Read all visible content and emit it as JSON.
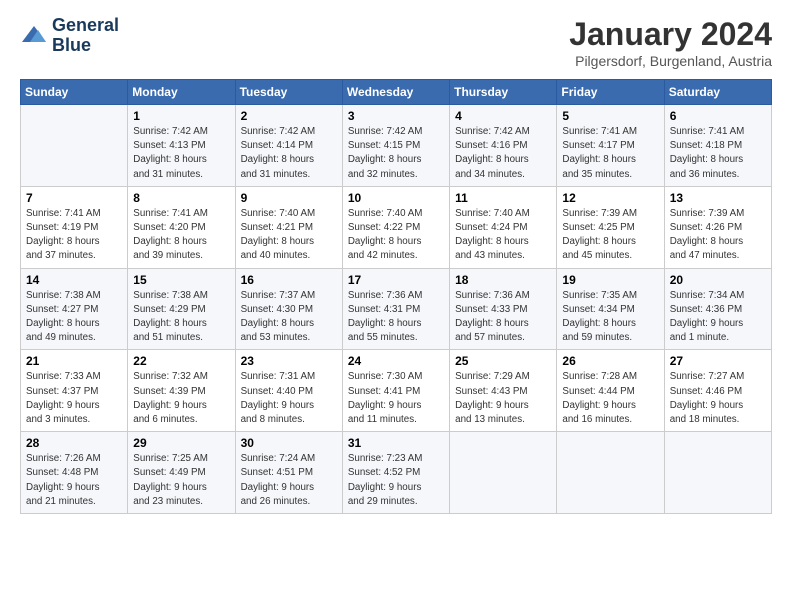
{
  "logo": {
    "line1": "General",
    "line2": "Blue"
  },
  "title": "January 2024",
  "subtitle": "Pilgersdorf, Burgenland, Austria",
  "headers": [
    "Sunday",
    "Monday",
    "Tuesday",
    "Wednesday",
    "Thursday",
    "Friday",
    "Saturday"
  ],
  "weeks": [
    [
      {
        "day": "",
        "info": ""
      },
      {
        "day": "1",
        "info": "Sunrise: 7:42 AM\nSunset: 4:13 PM\nDaylight: 8 hours\nand 31 minutes."
      },
      {
        "day": "2",
        "info": "Sunrise: 7:42 AM\nSunset: 4:14 PM\nDaylight: 8 hours\nand 31 minutes."
      },
      {
        "day": "3",
        "info": "Sunrise: 7:42 AM\nSunset: 4:15 PM\nDaylight: 8 hours\nand 32 minutes."
      },
      {
        "day": "4",
        "info": "Sunrise: 7:42 AM\nSunset: 4:16 PM\nDaylight: 8 hours\nand 34 minutes."
      },
      {
        "day": "5",
        "info": "Sunrise: 7:41 AM\nSunset: 4:17 PM\nDaylight: 8 hours\nand 35 minutes."
      },
      {
        "day": "6",
        "info": "Sunrise: 7:41 AM\nSunset: 4:18 PM\nDaylight: 8 hours\nand 36 minutes."
      }
    ],
    [
      {
        "day": "7",
        "info": "Sunrise: 7:41 AM\nSunset: 4:19 PM\nDaylight: 8 hours\nand 37 minutes."
      },
      {
        "day": "8",
        "info": "Sunrise: 7:41 AM\nSunset: 4:20 PM\nDaylight: 8 hours\nand 39 minutes."
      },
      {
        "day": "9",
        "info": "Sunrise: 7:40 AM\nSunset: 4:21 PM\nDaylight: 8 hours\nand 40 minutes."
      },
      {
        "day": "10",
        "info": "Sunrise: 7:40 AM\nSunset: 4:22 PM\nDaylight: 8 hours\nand 42 minutes."
      },
      {
        "day": "11",
        "info": "Sunrise: 7:40 AM\nSunset: 4:24 PM\nDaylight: 8 hours\nand 43 minutes."
      },
      {
        "day": "12",
        "info": "Sunrise: 7:39 AM\nSunset: 4:25 PM\nDaylight: 8 hours\nand 45 minutes."
      },
      {
        "day": "13",
        "info": "Sunrise: 7:39 AM\nSunset: 4:26 PM\nDaylight: 8 hours\nand 47 minutes."
      }
    ],
    [
      {
        "day": "14",
        "info": "Sunrise: 7:38 AM\nSunset: 4:27 PM\nDaylight: 8 hours\nand 49 minutes."
      },
      {
        "day": "15",
        "info": "Sunrise: 7:38 AM\nSunset: 4:29 PM\nDaylight: 8 hours\nand 51 minutes."
      },
      {
        "day": "16",
        "info": "Sunrise: 7:37 AM\nSunset: 4:30 PM\nDaylight: 8 hours\nand 53 minutes."
      },
      {
        "day": "17",
        "info": "Sunrise: 7:36 AM\nSunset: 4:31 PM\nDaylight: 8 hours\nand 55 minutes."
      },
      {
        "day": "18",
        "info": "Sunrise: 7:36 AM\nSunset: 4:33 PM\nDaylight: 8 hours\nand 57 minutes."
      },
      {
        "day": "19",
        "info": "Sunrise: 7:35 AM\nSunset: 4:34 PM\nDaylight: 8 hours\nand 59 minutes."
      },
      {
        "day": "20",
        "info": "Sunrise: 7:34 AM\nSunset: 4:36 PM\nDaylight: 9 hours\nand 1 minute."
      }
    ],
    [
      {
        "day": "21",
        "info": "Sunrise: 7:33 AM\nSunset: 4:37 PM\nDaylight: 9 hours\nand 3 minutes."
      },
      {
        "day": "22",
        "info": "Sunrise: 7:32 AM\nSunset: 4:39 PM\nDaylight: 9 hours\nand 6 minutes."
      },
      {
        "day": "23",
        "info": "Sunrise: 7:31 AM\nSunset: 4:40 PM\nDaylight: 9 hours\nand 8 minutes."
      },
      {
        "day": "24",
        "info": "Sunrise: 7:30 AM\nSunset: 4:41 PM\nDaylight: 9 hours\nand 11 minutes."
      },
      {
        "day": "25",
        "info": "Sunrise: 7:29 AM\nSunset: 4:43 PM\nDaylight: 9 hours\nand 13 minutes."
      },
      {
        "day": "26",
        "info": "Sunrise: 7:28 AM\nSunset: 4:44 PM\nDaylight: 9 hours\nand 16 minutes."
      },
      {
        "day": "27",
        "info": "Sunrise: 7:27 AM\nSunset: 4:46 PM\nDaylight: 9 hours\nand 18 minutes."
      }
    ],
    [
      {
        "day": "28",
        "info": "Sunrise: 7:26 AM\nSunset: 4:48 PM\nDaylight: 9 hours\nand 21 minutes."
      },
      {
        "day": "29",
        "info": "Sunrise: 7:25 AM\nSunset: 4:49 PM\nDaylight: 9 hours\nand 23 minutes."
      },
      {
        "day": "30",
        "info": "Sunrise: 7:24 AM\nSunset: 4:51 PM\nDaylight: 9 hours\nand 26 minutes."
      },
      {
        "day": "31",
        "info": "Sunrise: 7:23 AM\nSunset: 4:52 PM\nDaylight: 9 hours\nand 29 minutes."
      },
      {
        "day": "",
        "info": ""
      },
      {
        "day": "",
        "info": ""
      },
      {
        "day": "",
        "info": ""
      }
    ]
  ]
}
